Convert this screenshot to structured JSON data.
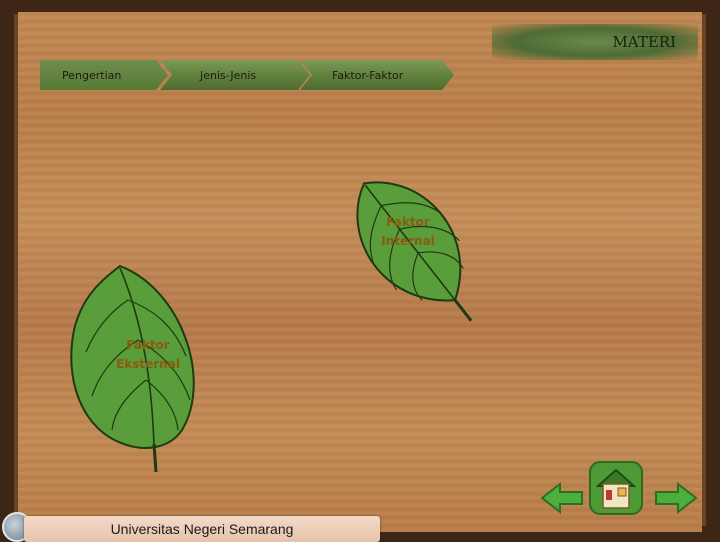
{
  "header": {
    "title": "MATERI"
  },
  "nav": {
    "items": [
      {
        "label": "Pengertian"
      },
      {
        "label": "Jenis-Jenis"
      },
      {
        "label": "Faktor-Faktor"
      }
    ]
  },
  "leaves": {
    "internal": {
      "line1": "Faktor",
      "line2": "Internal"
    },
    "external": {
      "line1": "Faktor",
      "line2": "Eksternal"
    }
  },
  "footer": {
    "university": "Universitas  Negeri Semarang"
  },
  "colors": {
    "leaf": "#5a9e3c",
    "nav": "#5f7f3c",
    "arrow": "#4caf3c",
    "label": "#8a5a12"
  },
  "icons": {
    "back": "left-arrow-icon",
    "home": "home-icon",
    "next": "right-arrow-icon"
  }
}
